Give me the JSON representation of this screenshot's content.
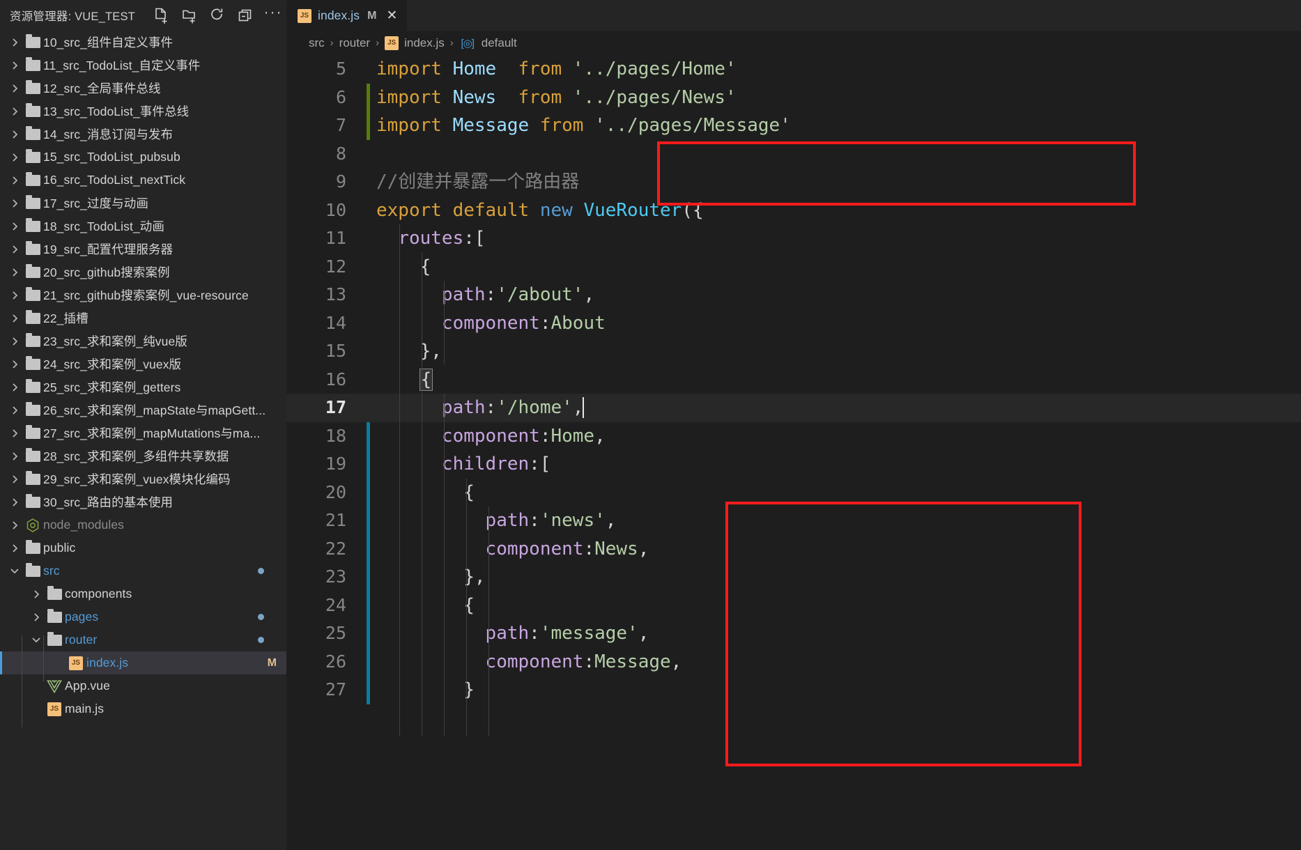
{
  "sidebar": {
    "header": {
      "title": "资源管理器: VUE_TEST",
      "actions": [
        {
          "name": "new-file-icon",
          "label": "新建文件"
        },
        {
          "name": "new-folder-icon",
          "label": "新建文件夹"
        },
        {
          "name": "refresh-icon",
          "label": "刷新"
        },
        {
          "name": "collapse-all-icon",
          "label": "折叠"
        },
        {
          "name": "more-actions-icon",
          "label": "…"
        }
      ]
    },
    "items": [
      {
        "label": "10_src_组件自定义事件",
        "type": "folder",
        "expanded": false,
        "indent": 0,
        "state": ""
      },
      {
        "label": "11_src_TodoList_自定义事件",
        "type": "folder",
        "expanded": false,
        "indent": 0,
        "state": ""
      },
      {
        "label": "12_src_全局事件总线",
        "type": "folder",
        "expanded": false,
        "indent": 0,
        "state": ""
      },
      {
        "label": "13_src_TodoList_事件总线",
        "type": "folder",
        "expanded": false,
        "indent": 0,
        "state": ""
      },
      {
        "label": "14_src_消息订阅与发布",
        "type": "folder",
        "expanded": false,
        "indent": 0,
        "state": ""
      },
      {
        "label": "15_src_TodoList_pubsub",
        "type": "folder",
        "expanded": false,
        "indent": 0,
        "state": ""
      },
      {
        "label": "16_src_TodoList_nextTick",
        "type": "folder",
        "expanded": false,
        "indent": 0,
        "state": ""
      },
      {
        "label": "17_src_过度与动画",
        "type": "folder",
        "expanded": false,
        "indent": 0,
        "state": ""
      },
      {
        "label": "18_src_TodoList_动画",
        "type": "folder",
        "expanded": false,
        "indent": 0,
        "state": ""
      },
      {
        "label": "19_src_配置代理服务器",
        "type": "folder",
        "expanded": false,
        "indent": 0,
        "state": ""
      },
      {
        "label": "20_src_github搜索案例",
        "type": "folder",
        "expanded": false,
        "indent": 0,
        "state": ""
      },
      {
        "label": "21_src_github搜索案例_vue-resource",
        "type": "folder",
        "expanded": false,
        "indent": 0,
        "state": ""
      },
      {
        "label": "22_插槽",
        "type": "folder",
        "expanded": false,
        "indent": 0,
        "state": ""
      },
      {
        "label": "23_src_求和案例_纯vue版",
        "type": "folder",
        "expanded": false,
        "indent": 0,
        "state": ""
      },
      {
        "label": "24_src_求和案例_vuex版",
        "type": "folder",
        "expanded": false,
        "indent": 0,
        "state": ""
      },
      {
        "label": "25_src_求和案例_getters",
        "type": "folder",
        "expanded": false,
        "indent": 0,
        "state": ""
      },
      {
        "label": "26_src_求和案例_mapState与mapGett...",
        "type": "folder",
        "expanded": false,
        "indent": 0,
        "state": ""
      },
      {
        "label": "27_src_求和案例_mapMutations与ma...",
        "type": "folder",
        "expanded": false,
        "indent": 0,
        "state": ""
      },
      {
        "label": "28_src_求和案例_多组件共享数据",
        "type": "folder",
        "expanded": false,
        "indent": 0,
        "state": ""
      },
      {
        "label": "29_src_求和案例_vuex模块化编码",
        "type": "folder",
        "expanded": false,
        "indent": 0,
        "state": ""
      },
      {
        "label": "30_src_路由的基本使用",
        "type": "folder",
        "expanded": false,
        "indent": 0,
        "state": ""
      },
      {
        "label": "node_modules",
        "type": "node",
        "expanded": false,
        "indent": 0,
        "state": "dim"
      },
      {
        "label": "public",
        "type": "folder",
        "expanded": false,
        "indent": 0,
        "state": ""
      },
      {
        "label": "src",
        "type": "folder",
        "expanded": true,
        "indent": 0,
        "state": "blue",
        "dot": true
      },
      {
        "label": "components",
        "type": "folder",
        "expanded": false,
        "indent": 1,
        "state": ""
      },
      {
        "label": "pages",
        "type": "folder",
        "expanded": false,
        "indent": 1,
        "state": "blue",
        "dot": true
      },
      {
        "label": "router",
        "type": "folder",
        "expanded": true,
        "indent": 1,
        "state": "blue",
        "dot": true
      },
      {
        "label": "index.js",
        "type": "js",
        "expanded": null,
        "indent": 2,
        "state": "blue",
        "selected": true,
        "badge": "M"
      },
      {
        "label": "App.vue",
        "type": "vue",
        "expanded": null,
        "indent": 1,
        "state": ""
      },
      {
        "label": "main.js",
        "type": "js",
        "expanded": null,
        "indent": 1,
        "state": ""
      }
    ]
  },
  "tab": {
    "filename": "index.js",
    "modified_badge": "M",
    "close_glyph": "✕",
    "icon": "js-file-icon"
  },
  "breadcrumb": {
    "parts": [
      "src",
      "router",
      "index.js",
      "default"
    ],
    "separator": "›",
    "symbol_glyph": "[◎]"
  },
  "editor": {
    "first_visible_line": 5,
    "active_line": 17,
    "lines": [
      {
        "n": "5",
        "tokens": [
          {
            "t": "import",
            "c": "t-kw"
          },
          {
            "t": " ",
            "c": "t-punc"
          },
          {
            "t": "Home",
            "c": "t-id"
          },
          {
            "t": "  ",
            "c": "t-punc"
          },
          {
            "t": "from",
            "c": "t-kw"
          },
          {
            "t": " ",
            "c": "t-punc"
          },
          {
            "t": "'../pages/Home'",
            "c": "t-str"
          }
        ]
      },
      {
        "n": "6",
        "change": "green",
        "tokens": [
          {
            "t": "import",
            "c": "t-kw"
          },
          {
            "t": " ",
            "c": "t-punc"
          },
          {
            "t": "News",
            "c": "t-id"
          },
          {
            "t": "  ",
            "c": "t-punc"
          },
          {
            "t": "from",
            "c": "t-kw"
          },
          {
            "t": " ",
            "c": "t-punc"
          },
          {
            "t": "'../pages/News'",
            "c": "t-str"
          }
        ]
      },
      {
        "n": "7",
        "change": "green",
        "tokens": [
          {
            "t": "import",
            "c": "t-kw"
          },
          {
            "t": " ",
            "c": "t-punc"
          },
          {
            "t": "Message",
            "c": "t-id"
          },
          {
            "t": " ",
            "c": "t-punc"
          },
          {
            "t": "from",
            "c": "t-kw"
          },
          {
            "t": " ",
            "c": "t-punc"
          },
          {
            "t": "'../pages/Message'",
            "c": "t-str"
          }
        ]
      },
      {
        "n": "8",
        "tokens": []
      },
      {
        "n": "9",
        "tokens": [
          {
            "t": "//创建并暴露一个路由器",
            "c": "t-cmt2"
          }
        ]
      },
      {
        "n": "10",
        "tokens": [
          {
            "t": "export",
            "c": "t-kw"
          },
          {
            "t": " ",
            "c": "t-punc"
          },
          {
            "t": "default",
            "c": "t-kw"
          },
          {
            "t": " ",
            "c": "t-punc"
          },
          {
            "t": "new",
            "c": "t-kw2"
          },
          {
            "t": " ",
            "c": "t-punc"
          },
          {
            "t": "VueRouter",
            "c": "t-cls"
          },
          {
            "t": "({",
            "c": "t-punc"
          }
        ]
      },
      {
        "n": "11",
        "tokens": [
          {
            "t": "  ",
            "c": "t-punc"
          },
          {
            "t": "routes",
            "c": "t-prop"
          },
          {
            "t": ":[",
            "c": "t-punc"
          }
        ]
      },
      {
        "n": "12",
        "tokens": [
          {
            "t": "    {",
            "c": "t-punc"
          }
        ]
      },
      {
        "n": "13",
        "tokens": [
          {
            "t": "      ",
            "c": "t-punc"
          },
          {
            "t": "path",
            "c": "t-prop"
          },
          {
            "t": ":",
            "c": "t-punc"
          },
          {
            "t": "'/about'",
            "c": "t-str"
          },
          {
            "t": ",",
            "c": "t-punc"
          }
        ]
      },
      {
        "n": "14",
        "tokens": [
          {
            "t": "      ",
            "c": "t-punc"
          },
          {
            "t": "component",
            "c": "t-prop"
          },
          {
            "t": ":",
            "c": "t-punc"
          },
          {
            "t": "About",
            "c": "t-val"
          }
        ]
      },
      {
        "n": "15",
        "tokens": [
          {
            "t": "    },",
            "c": "t-punc"
          }
        ]
      },
      {
        "n": "16",
        "bracketmatch": true,
        "tokens": [
          {
            "t": "    ",
            "c": "t-punc"
          },
          {
            "t": "{",
            "c": "t-punc bmatch"
          }
        ]
      },
      {
        "n": "17",
        "active": true,
        "caret": true,
        "tokens": [
          {
            "t": "      ",
            "c": "t-punc"
          },
          {
            "t": "path",
            "c": "t-prop"
          },
          {
            "t": ":",
            "c": "t-punc"
          },
          {
            "t": "'/home'",
            "c": "t-str"
          },
          {
            "t": ",",
            "c": "t-punc"
          }
        ]
      },
      {
        "n": "18",
        "change": "blue",
        "tokens": [
          {
            "t": "      ",
            "c": "t-punc"
          },
          {
            "t": "component",
            "c": "t-prop"
          },
          {
            "t": ":",
            "c": "t-punc"
          },
          {
            "t": "Home",
            "c": "t-val"
          },
          {
            "t": ",",
            "c": "t-punc"
          }
        ]
      },
      {
        "n": "19",
        "change": "blue",
        "tokens": [
          {
            "t": "      ",
            "c": "t-punc"
          },
          {
            "t": "children",
            "c": "t-prop"
          },
          {
            "t": ":[",
            "c": "t-punc"
          }
        ]
      },
      {
        "n": "20",
        "change": "blue",
        "tokens": [
          {
            "t": "        {",
            "c": "t-punc"
          }
        ]
      },
      {
        "n": "21",
        "change": "blue",
        "tokens": [
          {
            "t": "          ",
            "c": "t-punc"
          },
          {
            "t": "path",
            "c": "t-prop"
          },
          {
            "t": ":",
            "c": "t-punc"
          },
          {
            "t": "'news'",
            "c": "t-str"
          },
          {
            "t": ",",
            "c": "t-punc"
          }
        ]
      },
      {
        "n": "22",
        "change": "blue",
        "tokens": [
          {
            "t": "          ",
            "c": "t-punc"
          },
          {
            "t": "component",
            "c": "t-prop"
          },
          {
            "t": ":",
            "c": "t-punc"
          },
          {
            "t": "News",
            "c": "t-val"
          },
          {
            "t": ",",
            "c": "t-punc"
          }
        ]
      },
      {
        "n": "23",
        "change": "blue",
        "tokens": [
          {
            "t": "        },",
            "c": "t-punc"
          }
        ]
      },
      {
        "n": "24",
        "change": "blue",
        "tokens": [
          {
            "t": "        {",
            "c": "t-punc"
          }
        ]
      },
      {
        "n": "25",
        "change": "blue",
        "tokens": [
          {
            "t": "          ",
            "c": "t-punc"
          },
          {
            "t": "path",
            "c": "t-prop"
          },
          {
            "t": ":",
            "c": "t-punc"
          },
          {
            "t": "'message'",
            "c": "t-str"
          },
          {
            "t": ",",
            "c": "t-punc"
          }
        ]
      },
      {
        "n": "26",
        "change": "blue",
        "tokens": [
          {
            "t": "          ",
            "c": "t-punc"
          },
          {
            "t": "component",
            "c": "t-prop"
          },
          {
            "t": ":",
            "c": "t-punc"
          },
          {
            "t": "Message",
            "c": "t-val"
          },
          {
            "t": ",",
            "c": "t-punc"
          }
        ]
      },
      {
        "n": "27",
        "change": "blue",
        "tokens": [
          {
            "t": "        }",
            "c": "t-punc"
          }
        ]
      }
    ]
  },
  "annotations": [
    {
      "name": "redbox-imports",
      "color": "#fc1b1b",
      "covers": "lines 6-7 import News / import Message"
    },
    {
      "name": "redbox-children",
      "color": "#fc1b1b",
      "covers": "lines 19-27 children array block"
    }
  ],
  "colors": {
    "accent": "#4a9fd8",
    "annotation": "#fc1b1b",
    "editor_bg": "#1e1e1e",
    "sidebar_bg": "#252526",
    "change_added": "#587c0c",
    "change_modified": "#0c7d9d"
  }
}
